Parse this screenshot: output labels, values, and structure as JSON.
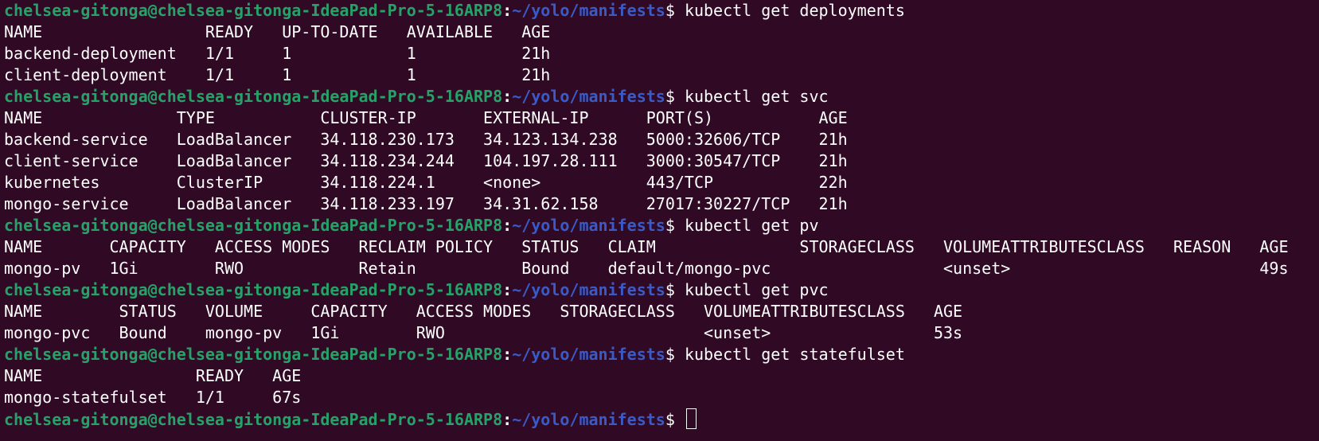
{
  "prompt": {
    "user_host": "chelsea-gitonga@chelsea-gitonga-IdeaPad-Pro-5-16ARP8",
    "separator": ":",
    "path": "~/yolo/manifests",
    "symbol": "$ "
  },
  "blocks": [
    {
      "command": "kubectl get deployments",
      "output": [
        "NAME                 READY   UP-TO-DATE   AVAILABLE   AGE",
        "backend-deployment   1/1     1            1           21h",
        "client-deployment    1/1     1            1           21h"
      ]
    },
    {
      "command": "kubectl get svc",
      "output": [
        "NAME              TYPE           CLUSTER-IP       EXTERNAL-IP      PORT(S)           AGE",
        "backend-service   LoadBalancer   34.118.230.173   34.123.134.238   5000:32606/TCP    21h",
        "client-service    LoadBalancer   34.118.234.244   104.197.28.111   3000:30547/TCP    21h",
        "kubernetes        ClusterIP      34.118.224.1     <none>           443/TCP           22h",
        "mongo-service     LoadBalancer   34.118.233.197   34.31.62.158     27017:30227/TCP   21h"
      ]
    },
    {
      "command": "kubectl get pv",
      "output": [
        "NAME       CAPACITY   ACCESS MODES   RECLAIM POLICY   STATUS   CLAIM               STORAGECLASS   VOLUMEATTRIBUTESCLASS   REASON   AGE",
        "mongo-pv   1Gi        RWO            Retain           Bound    default/mongo-pvc                  <unset>                          49s"
      ]
    },
    {
      "command": "kubectl get pvc",
      "output": [
        "NAME        STATUS   VOLUME     CAPACITY   ACCESS MODES   STORAGECLASS   VOLUMEATTRIBUTESCLASS   AGE",
        "mongo-pvc   Bound    mongo-pv   1Gi        RWO                           <unset>                 53s"
      ]
    },
    {
      "command": "kubectl get statefulset",
      "output": [
        "NAME                READY   AGE",
        "mongo-statefulset   1/1     67s"
      ]
    }
  ],
  "final_prompt_command": ""
}
